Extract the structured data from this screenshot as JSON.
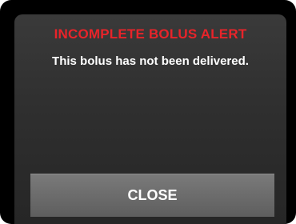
{
  "alert": {
    "title": "INCOMPLETE BOLUS ALERT",
    "message": "This bolus has not been delivered.",
    "close_label": "CLOSE"
  },
  "colors": {
    "title": "#e8242a",
    "screen": "#333333",
    "button": "#6c6c6c",
    "text": "#ffffff"
  }
}
